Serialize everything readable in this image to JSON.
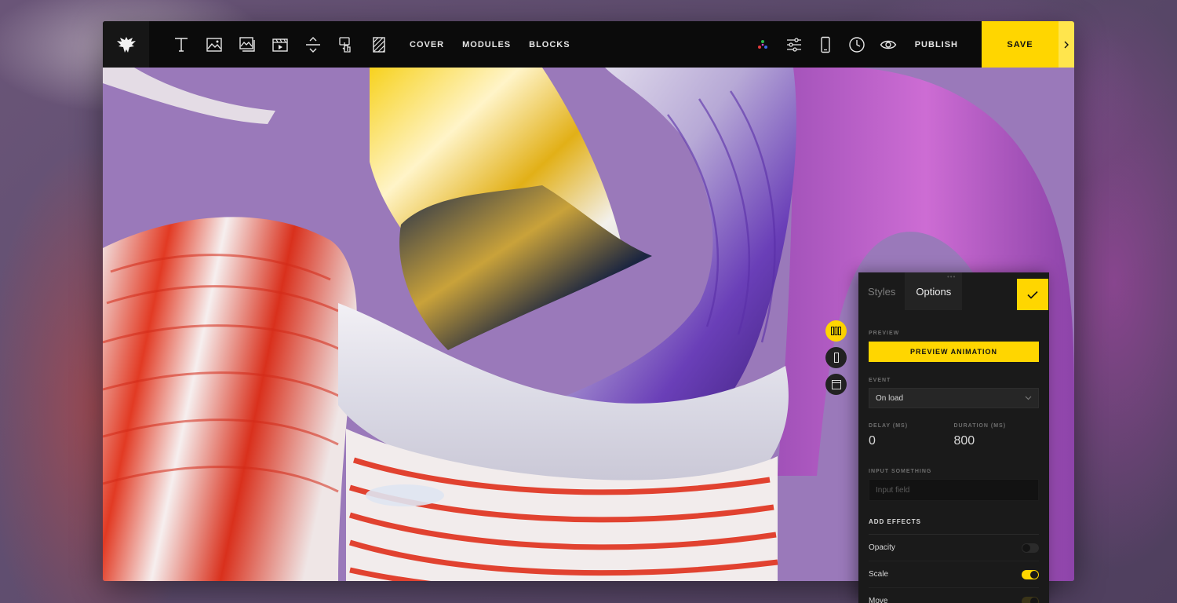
{
  "toolbar": {
    "tools": [
      {
        "name": "text-tool",
        "icon": "text-icon"
      },
      {
        "name": "image-tool",
        "icon": "image-icon"
      },
      {
        "name": "gallery-tool",
        "icon": "gallery-icon"
      },
      {
        "name": "video-tool",
        "icon": "video-icon"
      },
      {
        "name": "spacer-tool",
        "icon": "spacer-icon"
      },
      {
        "name": "button-tool",
        "icon": "hand-pointer-icon"
      },
      {
        "name": "pattern-tool",
        "icon": "hatch-icon"
      }
    ],
    "links": [
      "COVER",
      "MODULES",
      "BLOCKS"
    ],
    "right_icons": [
      "color-dots-icon",
      "sliders-icon",
      "mobile-icon",
      "clock-icon",
      "eye-icon"
    ],
    "publish_label": "PUBLISH",
    "save_label": "SAVE",
    "accent": "#ffd600"
  },
  "side_toggles": [
    "grid-view-icon",
    "column-view-icon",
    "frame-view-icon"
  ],
  "panel": {
    "tabs": [
      "Styles",
      "Options"
    ],
    "active_tab": "Options",
    "preview_label": "PREVIEW",
    "preview_button": "PREVIEW ANIMATION",
    "event_label": "EVENT",
    "event_value": "On load",
    "delay_label": "DELAY (MS)",
    "delay_value": "0",
    "duration_label": "DURATION (MS)",
    "duration_value": "800",
    "input_label": "INPUT SOMETHING",
    "input_placeholder": "Input field",
    "effects_label": "ADD EFFECTS",
    "effects": [
      {
        "label": "Opacity",
        "on": false
      },
      {
        "label": "Scale",
        "on": true
      },
      {
        "label": "Move",
        "on": true
      }
    ]
  }
}
